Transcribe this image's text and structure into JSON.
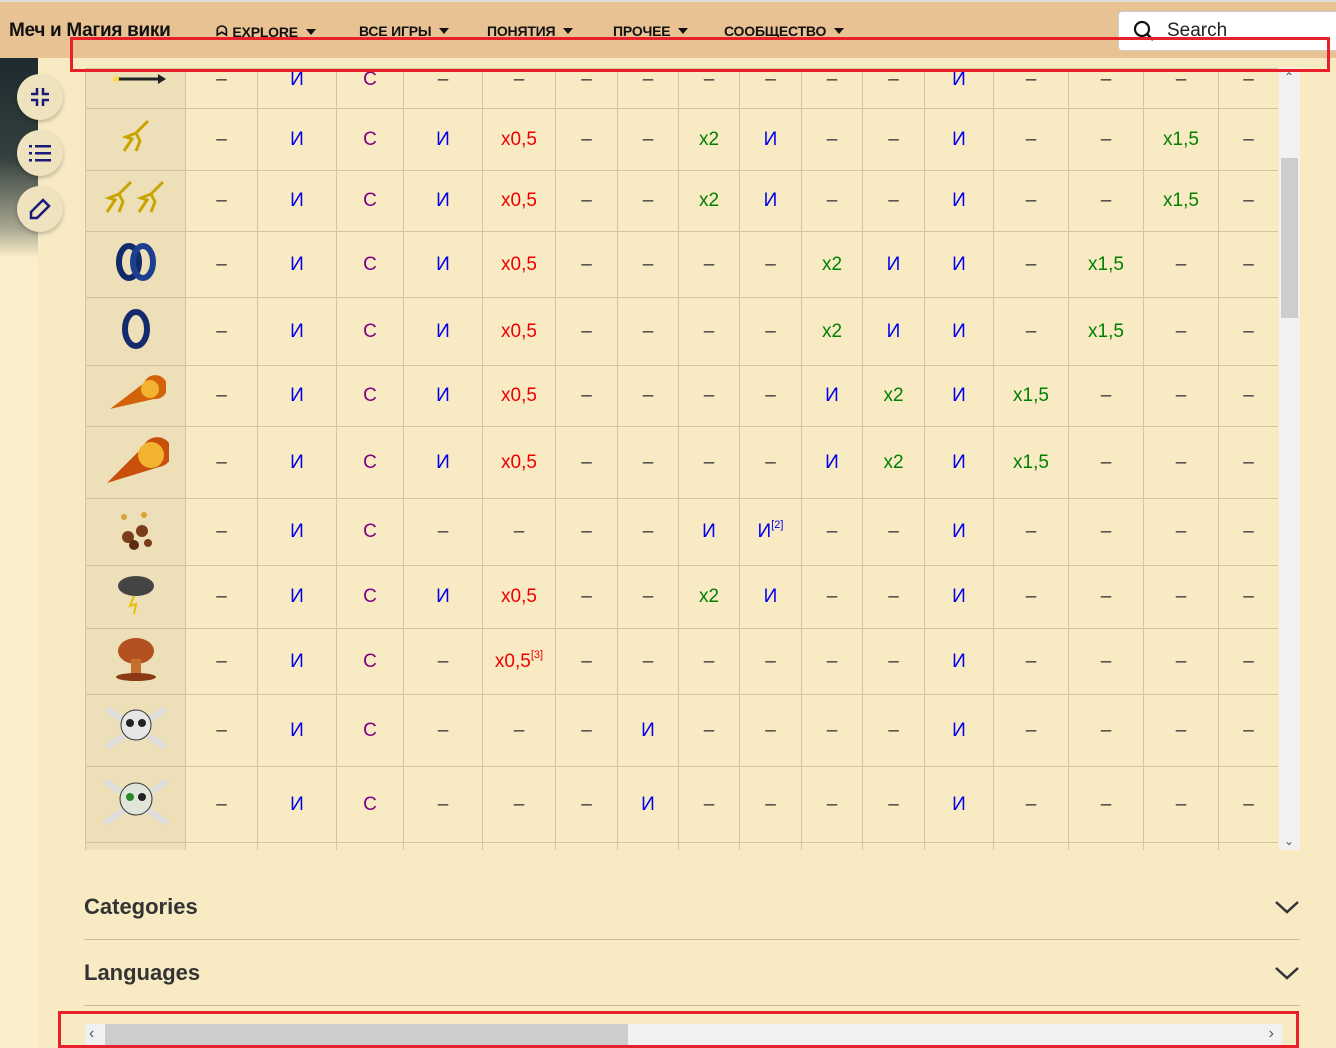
{
  "header": {
    "title": "Меч и Магия вики",
    "nav": [
      {
        "label": "EXPLORE"
      },
      {
        "label": "ВСЕ ИГРЫ"
      },
      {
        "label": "ПОНЯТИЯ"
      },
      {
        "label": "ПРОЧЕЕ"
      },
      {
        "label": "СООБЩЕСТВО"
      }
    ],
    "search_placeholder": "Search"
  },
  "rows": [
    {
      "icon": "arrow",
      "cells": [
        "–",
        "И",
        "С",
        "–",
        "–",
        "–",
        "–",
        "–",
        "–",
        "–",
        "–",
        "И",
        "–",
        "–",
        "–",
        "–"
      ]
    },
    {
      "icon": "lightning",
      "cells": [
        "–",
        "И",
        "С",
        "И",
        "x0,5",
        "–",
        "–",
        "x2",
        "И",
        "–",
        "–",
        "И",
        "–",
        "–",
        "x1,5",
        "–"
      ]
    },
    {
      "icon": "double-lightning",
      "cells": [
        "–",
        "И",
        "С",
        "И",
        "x0,5",
        "–",
        "–",
        "x2",
        "И",
        "–",
        "–",
        "И",
        "–",
        "–",
        "x1,5",
        "–"
      ]
    },
    {
      "icon": "double-ring",
      "cells": [
        "–",
        "И",
        "С",
        "И",
        "x0,5",
        "–",
        "–",
        "–",
        "–",
        "x2",
        "И",
        "И",
        "–",
        "x1,5",
        "–",
        "–"
      ]
    },
    {
      "icon": "ring",
      "cells": [
        "–",
        "И",
        "С",
        "И",
        "x0,5",
        "–",
        "–",
        "–",
        "–",
        "x2",
        "И",
        "И",
        "–",
        "x1,5",
        "–",
        "–"
      ]
    },
    {
      "icon": "fireball-small",
      "cells": [
        "–",
        "И",
        "С",
        "И",
        "x0,5",
        "–",
        "–",
        "–",
        "–",
        "И",
        "x2",
        "И",
        "x1,5",
        "–",
        "–",
        "–"
      ]
    },
    {
      "icon": "fireball-large",
      "cells": [
        "–",
        "И",
        "С",
        "И",
        "x0,5",
        "–",
        "–",
        "–",
        "–",
        "И",
        "x2",
        "И",
        "x1,5",
        "–",
        "–",
        "–"
      ]
    },
    {
      "icon": "meteor-shower",
      "cells": [
        "–",
        "И",
        "С",
        "–",
        "–",
        "–",
        "–",
        "И",
        "И[2]",
        "–",
        "–",
        "И",
        "–",
        "–",
        "–",
        "–"
      ]
    },
    {
      "icon": "storm-cloud",
      "cells": [
        "–",
        "И",
        "С",
        "И",
        "x0,5",
        "–",
        "–",
        "x2",
        "И",
        "–",
        "–",
        "И",
        "–",
        "–",
        "–",
        "–"
      ]
    },
    {
      "icon": "mushroom-cloud",
      "cells": [
        "–",
        "И",
        "С",
        "–",
        "x0,5[3]",
        "–",
        "–",
        "–",
        "–",
        "–",
        "–",
        "И",
        "–",
        "–",
        "–",
        "–"
      ]
    },
    {
      "icon": "skull-crossbones",
      "cells": [
        "–",
        "И",
        "С",
        "–",
        "–",
        "–",
        "И",
        "–",
        "–",
        "–",
        "–",
        "И",
        "–",
        "–",
        "–",
        "–"
      ]
    },
    {
      "icon": "skull-crossbones-green",
      "cells": [
        "–",
        "И",
        "С",
        "–",
        "–",
        "–",
        "И",
        "–",
        "–",
        "–",
        "–",
        "И",
        "–",
        "–",
        "–",
        "–"
      ]
    }
  ],
  "sections": [
    {
      "label": "Categories"
    },
    {
      "label": "Languages"
    }
  ],
  "colors": {
    "header": "#e8c293",
    "page": "#f8ebc4",
    "immune": "#0000ee",
    "special": "#800080",
    "reduced": "#ee0000",
    "increased": "#008000"
  }
}
